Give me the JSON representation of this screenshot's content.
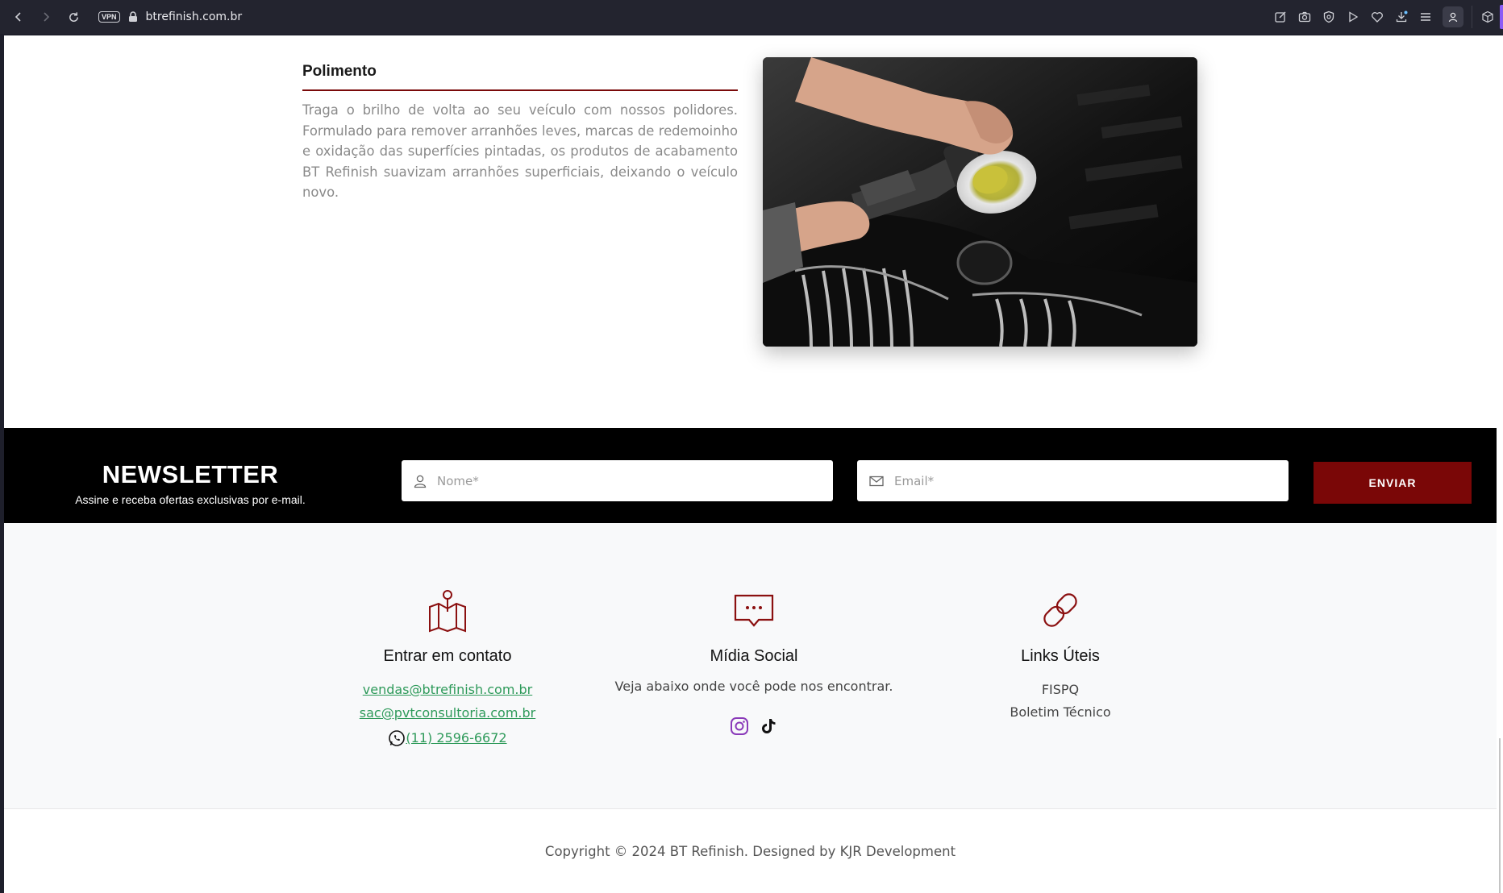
{
  "browser": {
    "url": "btrefinish.com.br",
    "vpn_label": "VPN"
  },
  "product": {
    "title": "Polimento",
    "description": "Traga o brilho de volta ao seu veículo com nossos polidores. Formulado para remover arranhões leves, marcas de redemoinho e oxidação das superfícies pintadas, os produtos de acabamento BT Refinish suavizam arranhões superficiais, deixando o veículo novo."
  },
  "newsletter": {
    "title": "NEWSLETTER",
    "subtitle": "Assine e receba ofertas exclusivas por e-mail.",
    "name_placeholder": "Nome*",
    "email_placeholder": "Email*",
    "submit_label": "ENVIAR"
  },
  "footer": {
    "contact": {
      "title": "Entrar em contato",
      "email_sales": "vendas@btrefinish.com.br",
      "email_sac": "sac@pvtconsultoria.com.br",
      "phone": " (11) 2596-6672"
    },
    "social": {
      "title": "Mídia Social",
      "text": "Veja abaixo onde você pode nos encontrar."
    },
    "links": {
      "title": "Links Úteis",
      "items": [
        "FISPQ",
        "Boletim Técnico"
      ]
    }
  },
  "copyright": "Copyright © 2024 BT Refinish. Designed by KJR Development",
  "colors": {
    "brand": "#7a0707",
    "link": "#2e9a5a",
    "newsletter_bg": "#000000",
    "footer_bg": "#f8f9fa"
  }
}
